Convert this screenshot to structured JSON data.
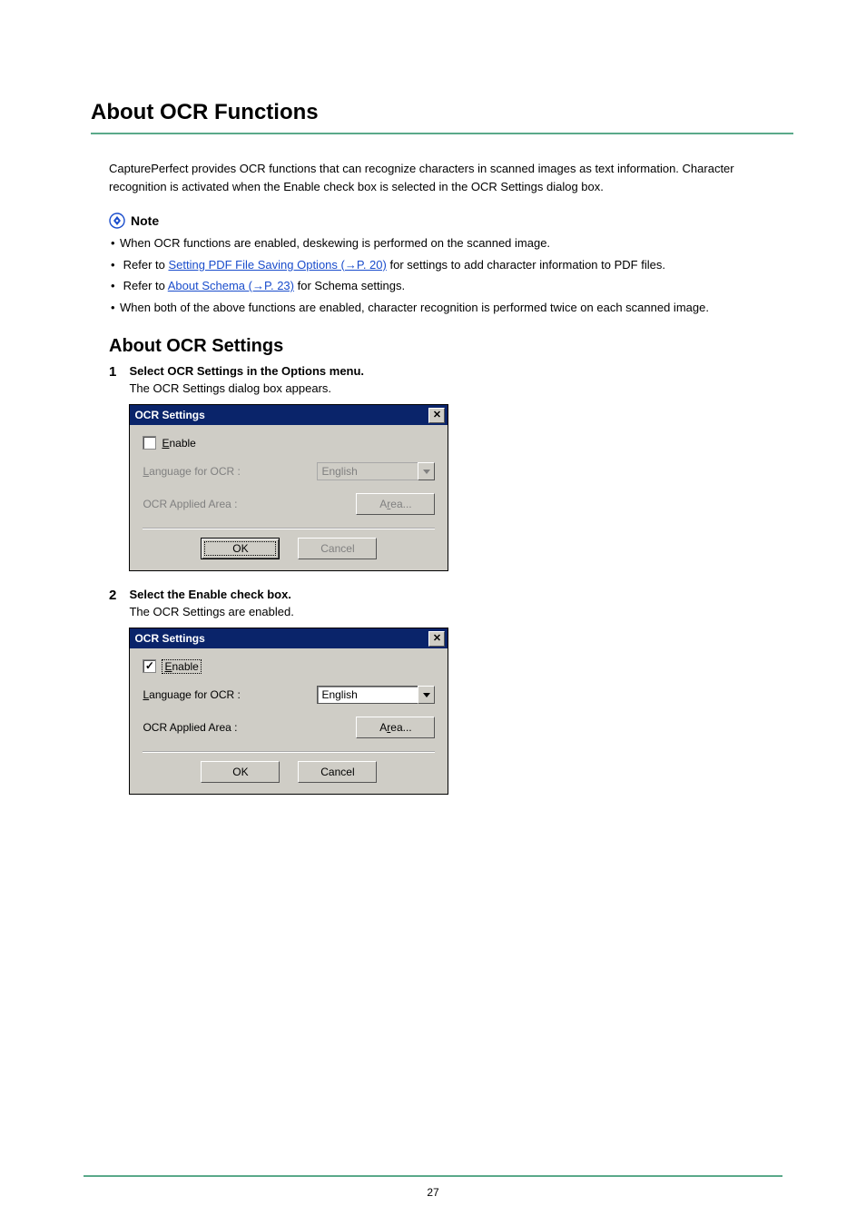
{
  "title": "About OCR Functions",
  "intro": "CapturePerfect provides OCR functions that can recognize characters in scanned images as text information. Character recognition is activated when the Enable check box is selected in the OCR Settings dialog box.",
  "note_label": "Note",
  "notes": {
    "n1": "When OCR functions are enabled, deskewing is performed on the scanned image.",
    "n2_pre": "Refer to ",
    "n2_link": "Setting PDF File Saving Options (→P. 20)",
    "n2_post": "  for settings to add character information to PDF files.",
    "n3_pre": "Refer to ",
    "n3_link": "About Schema (→P. 23)",
    "n3_post": "  for Schema settings.",
    "n4": "When both of the above functions are enabled, character recognition is performed twice on each scanned image."
  },
  "subtitle": "About OCR Settings",
  "steps": {
    "s1": {
      "num": "1",
      "title": "Select OCR Settings in the Options menu.",
      "desc": "The OCR Settings dialog box appears."
    },
    "s2": {
      "num": "2",
      "title": "Select the Enable check box.",
      "desc": "The OCR Settings are enabled."
    }
  },
  "dialog": {
    "title": "OCR Settings",
    "enable_u": "E",
    "enable_rest": "nable",
    "lang_u": "L",
    "lang_rest": "anguage for OCR :",
    "lang_value": "English",
    "area_label": "OCR Applied Area :",
    "area_btn_pre": "A",
    "area_btn_u": "r",
    "area_btn_post": "ea...",
    "ok": "OK",
    "cancel": "Cancel"
  },
  "page_number": "27"
}
